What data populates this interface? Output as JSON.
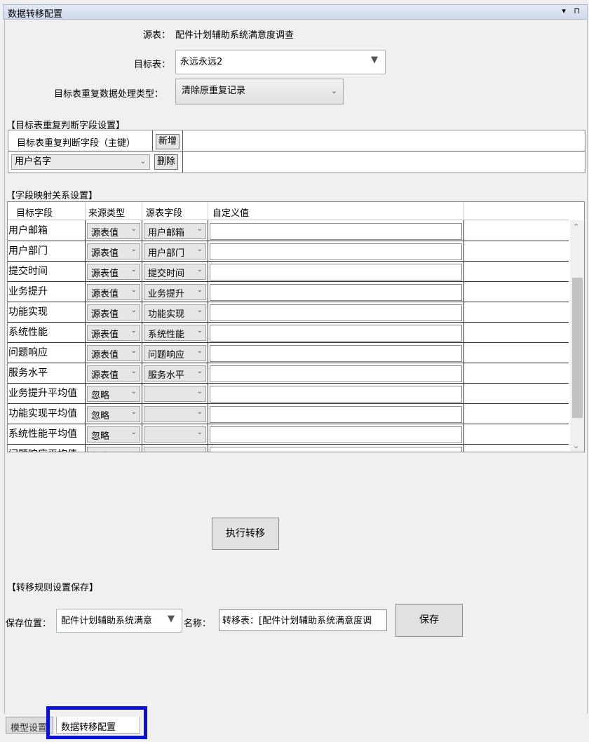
{
  "window": {
    "title": "数据转移配置",
    "pin_icons": "▾ ⊓"
  },
  "source": {
    "label": "源表：",
    "value": "配件计划辅助系统满意度调查"
  },
  "target": {
    "label": "目标表：",
    "value": "永远永远2"
  },
  "dup_mode": {
    "label": "目标表重复数据处理类型：",
    "value": "清除原重复记录"
  },
  "dup_section": {
    "title": "【目标表重复判断字段设置】",
    "field_header": "目标表重复判断字段（主键）",
    "add_label": "新增",
    "field_value": "用户名字",
    "delete_label": "删除"
  },
  "mapping": {
    "title": "【字段映射关系设置】",
    "columns": [
      "目标字段",
      "来源类型",
      "源表字段",
      "自定义值"
    ],
    "rows": [
      {
        "target": "用户邮箱",
        "type": "源表值",
        "source": "用户邮箱"
      },
      {
        "target": "用户部门",
        "type": "源表值",
        "source": "用户部门"
      },
      {
        "target": "提交时间",
        "type": "源表值",
        "source": "提交时间"
      },
      {
        "target": "业务提升",
        "type": "源表值",
        "source": "业务提升"
      },
      {
        "target": "功能实现",
        "type": "源表值",
        "source": "功能实现"
      },
      {
        "target": "系统性能",
        "type": "源表值",
        "source": "系统性能"
      },
      {
        "target": "问题响应",
        "type": "源表值",
        "source": "问题响应"
      },
      {
        "target": "服务水平",
        "type": "源表值",
        "source": "服务水平"
      },
      {
        "target": "业务提升平均值",
        "type": "忽略",
        "source": ""
      },
      {
        "target": "功能实现平均值",
        "type": "忽略",
        "source": ""
      },
      {
        "target": "系统性能平均值",
        "type": "忽略",
        "source": ""
      },
      {
        "target": "问题响应平均值",
        "type": "忽略",
        "source": ""
      }
    ]
  },
  "execute_label": "执行转移",
  "save_section": {
    "title": "【转移规则设置保存】",
    "location_label": "保存位置：",
    "location_value": "配件计划辅助系统满意",
    "name_label": "名称：",
    "name_value": "转移表：[配件计划辅助系统满意度调",
    "save_label": "保存"
  },
  "tabs": [
    "模型设置",
    "数据转移配置"
  ]
}
